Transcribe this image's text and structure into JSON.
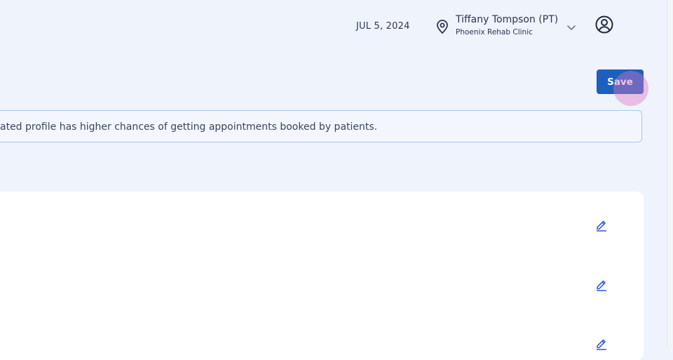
{
  "header": {
    "date": "JUL 5, 2024",
    "location_icon": "map-pin-icon",
    "user_name": "Tiffany Tompson (PT)",
    "clinic_name": "Phoenix Rehab Clinic",
    "dropdown_icon": "chevron-down-icon",
    "avatar_icon": "user-circle-icon"
  },
  "toolbar": {
    "save_label": "Save"
  },
  "banner": {
    "text": "ated profile has higher chances of getting appointments booked by patients."
  },
  "card": {
    "edit_icons": [
      "pencil-icon",
      "pencil-icon",
      "pencil-icon"
    ]
  },
  "colors": {
    "page_background": "#eff3fc",
    "primary_button": "#1c5fbf",
    "banner_border": "#a9c6e6",
    "edit_icon": "#3b63d8"
  }
}
